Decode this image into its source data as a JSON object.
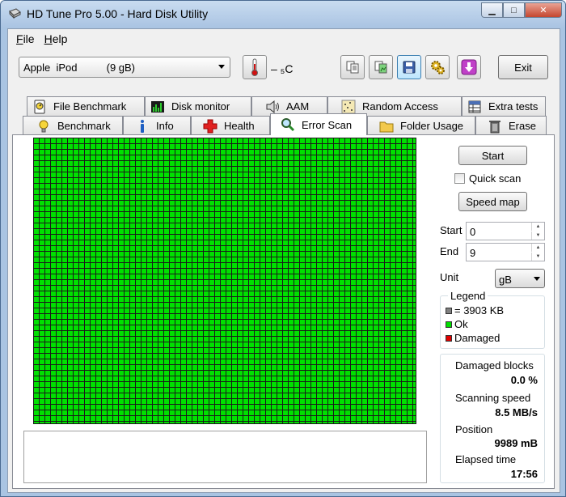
{
  "window": {
    "title": "HD Tune Pro 5.00 - Hard Disk Utility",
    "minimize_glyph": "▁",
    "maximize_glyph": "□",
    "close_glyph": "✕"
  },
  "menu": [
    {
      "label": "File",
      "underline": "F",
      "rest": "ile"
    },
    {
      "label": "Help",
      "underline": "H",
      "rest": "elp"
    }
  ],
  "toolbar": {
    "drive_selected": "Apple  iPod          (9 gB)",
    "temperature": "– ₅C",
    "exit_label": "Exit",
    "buttons": [
      "copy-info-icon",
      "copy-screenshot-icon",
      "save-icon",
      "options-icon",
      "download-icon"
    ]
  },
  "tabs_top": [
    {
      "label": "File Benchmark",
      "icon": "file-benchmark-icon"
    },
    {
      "label": "Disk monitor",
      "icon": "disk-monitor-icon"
    },
    {
      "label": "AAM",
      "icon": "speaker-icon"
    },
    {
      "label": "Random Access",
      "icon": "random-access-icon"
    },
    {
      "label": "Extra tests",
      "icon": "extra-tests-icon"
    }
  ],
  "tabs_bottom": [
    {
      "label": "Benchmark",
      "icon": "lightbulb-icon"
    },
    {
      "label": "Info",
      "icon": "info-icon"
    },
    {
      "label": "Health",
      "icon": "health-cross-icon"
    },
    {
      "label": "Error Scan",
      "icon": "magnifier-icon",
      "active": true
    },
    {
      "label": "Folder Usage",
      "icon": "folder-icon"
    },
    {
      "label": "Erase",
      "icon": "trash-icon"
    }
  ],
  "scan": {
    "start_button": "Start",
    "quick_scan_label": "Quick scan",
    "quick_scan_checked": false,
    "speed_map_button": "Speed map",
    "start_label": "Start",
    "start_value": "0",
    "end_label": "End",
    "end_value": "9",
    "unit_label": "Unit",
    "unit_value": "gB"
  },
  "legend": {
    "title": "Legend",
    "items": [
      {
        "label": "= 3903 KB",
        "color": "#808080"
      },
      {
        "label": "Ok",
        "color": "#00e000"
      },
      {
        "label": "Damaged",
        "color": "#e00000"
      }
    ]
  },
  "stats": {
    "damaged_blocks_label": "Damaged blocks",
    "damaged_blocks_value": "0.0 %",
    "scanning_speed_label": "Scanning speed",
    "scanning_speed_value": "8.5 MB/s",
    "position_label": "Position",
    "position_value": "9989 mB",
    "elapsed_label": "Elapsed time",
    "elapsed_value": "17:56"
  },
  "colors": {
    "block_ok": "#00e000",
    "grid_line": "#1a1a1a"
  }
}
